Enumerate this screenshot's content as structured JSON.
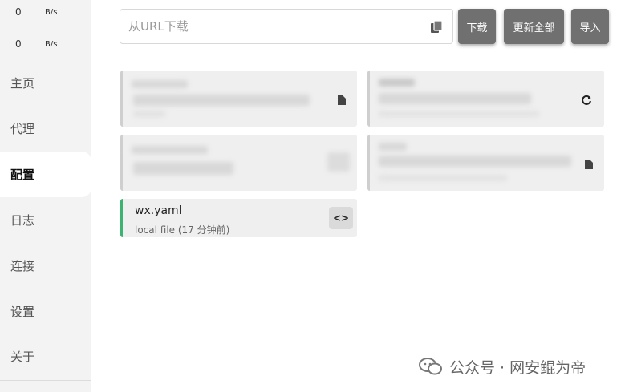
{
  "speed": {
    "upload": {
      "value": "0",
      "unit": "B/s"
    },
    "download": {
      "value": "0",
      "unit": "B/s"
    }
  },
  "sidebar": {
    "items": [
      {
        "label": "主页"
      },
      {
        "label": "代理"
      },
      {
        "label": "配置"
      },
      {
        "label": "日志"
      },
      {
        "label": "连接"
      },
      {
        "label": "设置"
      },
      {
        "label": "关于"
      }
    ],
    "active": "配置"
  },
  "toolbar": {
    "url_placeholder": "从URL下载",
    "url_value": "",
    "download_label": "下载",
    "update_all_label": "更新全部",
    "import_label": "导入"
  },
  "profiles": [
    {
      "title": "",
      "subtitle": "",
      "blurred": true,
      "icon": "file-icon"
    },
    {
      "title": "",
      "subtitle": "",
      "blurred": true,
      "icon": "refresh-icon"
    },
    {
      "title": "",
      "subtitle": "",
      "blurred": true,
      "icon": "file-icon"
    },
    {
      "title": "",
      "subtitle": "",
      "blurred": true,
      "icon": "file-icon"
    },
    {
      "title": "wx.yaml",
      "subtitle": "local file (17 分钟前)",
      "blurred": false,
      "icon": "code-icon",
      "icon_text": "<>",
      "accent": "#3cb371"
    }
  ],
  "watermark": {
    "text": "公众号 · 网安鲲为帝"
  }
}
